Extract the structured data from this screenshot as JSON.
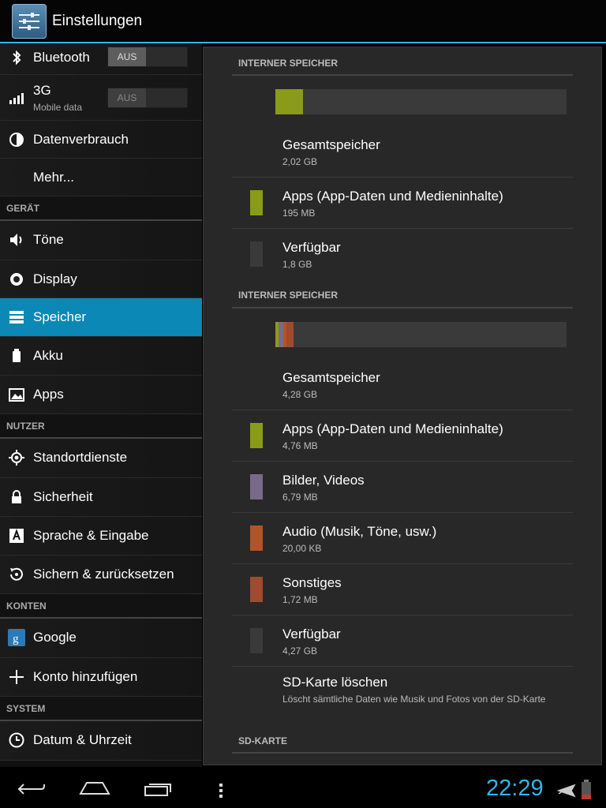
{
  "actionbar": {
    "title": "Einstellungen"
  },
  "sidebar": {
    "bluetooth": {
      "label": "Bluetooth",
      "toggle": "AUS"
    },
    "g3": {
      "label": "3G",
      "sub": "Mobile data",
      "toggle": "AUS"
    },
    "datenverbrauch": "Datenverbrauch",
    "mehr": "Mehr...",
    "section_geraet": "GERÄT",
    "toene": "Töne",
    "display": "Display",
    "speicher": "Speicher",
    "akku": "Akku",
    "apps": "Apps",
    "section_nutzer": "NUTZER",
    "standort": "Standortdienste",
    "sicherheit": "Sicherheit",
    "sprache": "Sprache & Eingabe",
    "sichern": "Sichern & zurücksetzen",
    "section_konten": "KONTEN",
    "google": "Google",
    "konto": "Konto hinzufügen",
    "section_system": "SYSTEM",
    "datum": "Datum & Uhrzeit"
  },
  "storage1": {
    "header": "INTERNER SPEICHER",
    "usage": [
      {
        "name": "apps",
        "color": "#8a9a1a",
        "fraction": 0.094
      }
    ],
    "total": {
      "title": "Gesamtspeicher",
      "value": "2,02 GB"
    },
    "apps": {
      "title": "Apps (App-Daten und Medieninhalte)",
      "value": "195 MB",
      "color": "#8a9a1a"
    },
    "free": {
      "title": "Verfügbar",
      "value": "1,8 GB",
      "color": "#3a3a3a"
    }
  },
  "storage2": {
    "header": "INTERNER SPEICHER",
    "usage": [
      {
        "name": "apps",
        "color": "#8a9a1a",
        "fraction": 0.011
      },
      {
        "name": "bilder",
        "color": "#7a6a8a",
        "fraction": 0.016
      },
      {
        "name": "audio",
        "color": "#b0552a",
        "fraction": 0.01
      },
      {
        "name": "sonstiges",
        "color": "#a04a30",
        "fraction": 0.025
      }
    ],
    "total": {
      "title": "Gesamtspeicher",
      "value": "4,28 GB"
    },
    "apps": {
      "title": "Apps (App-Daten und Medieninhalte)",
      "value": "4,76 MB",
      "color": "#8a9a1a"
    },
    "bilder": {
      "title": "Bilder, Videos",
      "value": "6,79 MB",
      "color": "#7a6a8a"
    },
    "audio": {
      "title": "Audio (Musik, Töne, usw.)",
      "value": "20,00 KB",
      "color": "#b0552a"
    },
    "sonstiges": {
      "title": "Sonstiges",
      "value": "1,72 MB",
      "color": "#a04a30"
    },
    "free": {
      "title": "Verfügbar",
      "value": "4,27 GB",
      "color": "#3a3a3a"
    },
    "erase": {
      "title": "SD-Karte löschen",
      "desc": "Löscht sämtliche Daten wie Musik und Fotos von der SD-Karte"
    }
  },
  "storage3": {
    "header": "SD-KARTE"
  },
  "navbar": {
    "clock": "22:29"
  }
}
